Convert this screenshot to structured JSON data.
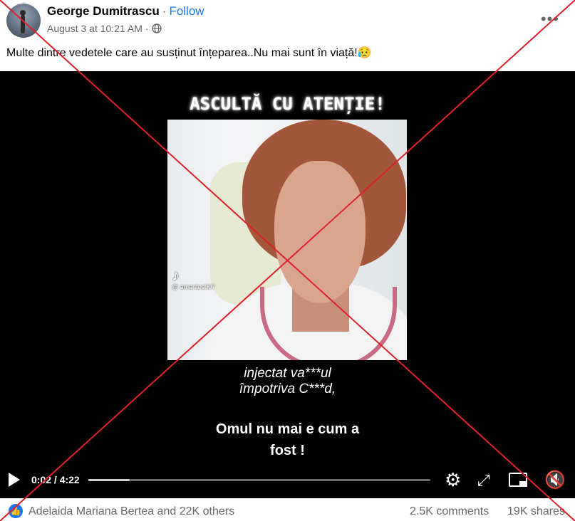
{
  "post": {
    "author": "George Dumitrascu",
    "separator": "·",
    "follow_label": "Follow",
    "timestamp": "August 3 at 10:21 AM",
    "privacy_icon": "globe-icon",
    "more_icon": "more-options-icon",
    "text": "Multe dintre vedetele care au susținut înțeparea..Nu mai sunt în viață!😥"
  },
  "video": {
    "banner": "ASCULTĂ CU ATENȚIE!",
    "watermark_logo": "tiktok-logo",
    "watermark_handle": "@ amantes007",
    "subtitle_line1": "injectat va***ul",
    "subtitle_line2": "împotriva C***d,",
    "caption_line1": "Omul nu mai e cum a",
    "caption_line2": "fost !",
    "time_display": "0:02 / 4:22",
    "progress_fraction": 0.12
  },
  "controls": {
    "play_icon": "play-icon",
    "settings_icon": "gear-icon",
    "fullscreen_icon": "expand-icon",
    "pip_icon": "picture-in-picture-icon",
    "volume_icon": "volume-muted-icon"
  },
  "footer": {
    "reactions_icon": "like-icon",
    "reactors": "Adelaida Mariana Bertea and 22K others",
    "comments": "2.5K comments",
    "shares": "19K shares"
  },
  "colors": {
    "brand_blue": "#1877f2",
    "overlay_cross": "#e0202b",
    "secondary_text": "#65676b"
  }
}
